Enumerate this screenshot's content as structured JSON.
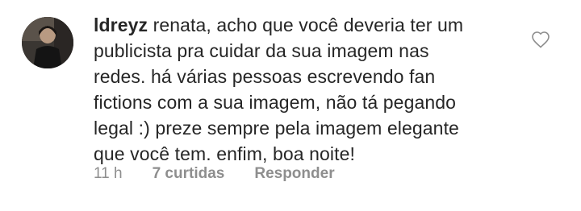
{
  "comment": {
    "username": "ldreyz",
    "text": "renata, acho que você deveria ter um\npublicista pra cuidar da sua imagem nas\nredes. há várias pessoas escrevendo fan\nfictions com a sua imagem, não tá pegando\nlegal :) preze sempre pela imagem elegante\nque você tem. enfim, boa noite!",
    "time": "11 h",
    "likes": "7 curtidas",
    "reply_label": "Responder",
    "like_icon": "heart-outline-icon"
  },
  "colors": {
    "text": "#262626",
    "meta": "#8e8e8e",
    "icon": "#8e8e8e",
    "background": "#ffffff"
  }
}
